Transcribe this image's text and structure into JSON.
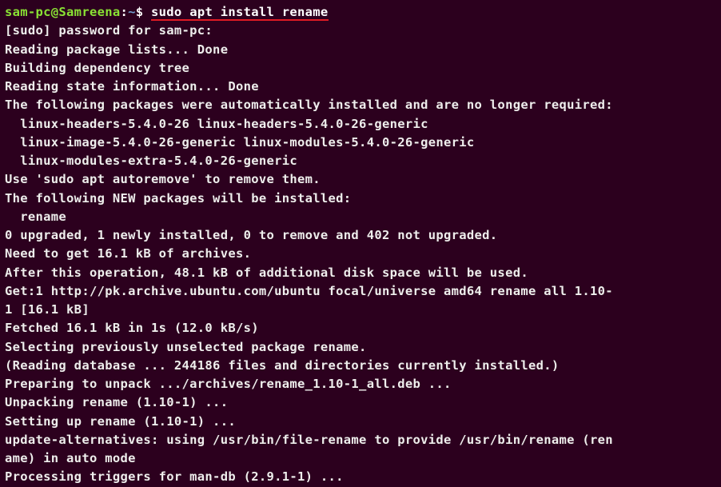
{
  "prompt": {
    "user_host": "sam-pc@Samreena",
    "colon": ":",
    "path": "~",
    "dollar": "$ ",
    "command": "sudo apt install rename"
  },
  "output": {
    "lines": [
      "[sudo] password for sam-pc:",
      "Reading package lists... Done",
      "Building dependency tree",
      "Reading state information... Done",
      "The following packages were automatically installed and are no longer required:",
      "  linux-headers-5.4.0-26 linux-headers-5.4.0-26-generic",
      "  linux-image-5.4.0-26-generic linux-modules-5.4.0-26-generic",
      "  linux-modules-extra-5.4.0-26-generic",
      "Use 'sudo apt autoremove' to remove them.",
      "The following NEW packages will be installed:",
      "  rename",
      "0 upgraded, 1 newly installed, 0 to remove and 402 not upgraded.",
      "Need to get 16.1 kB of archives.",
      "After this operation, 48.1 kB of additional disk space will be used.",
      "Get:1 http://pk.archive.ubuntu.com/ubuntu focal/universe amd64 rename all 1.10-",
      "1 [16.1 kB]",
      "Fetched 16.1 kB in 1s (12.0 kB/s)",
      "Selecting previously unselected package rename.",
      "(Reading database ... 244186 files and directories currently installed.)",
      "Preparing to unpack .../archives/rename_1.10-1_all.deb ...",
      "Unpacking rename (1.10-1) ...",
      "Setting up rename (1.10-1) ...",
      "update-alternatives: using /usr/bin/file-rename to provide /usr/bin/rename (ren",
      "ame) in auto mode",
      "Processing triggers for man-db (2.9.1-1) ..."
    ]
  }
}
